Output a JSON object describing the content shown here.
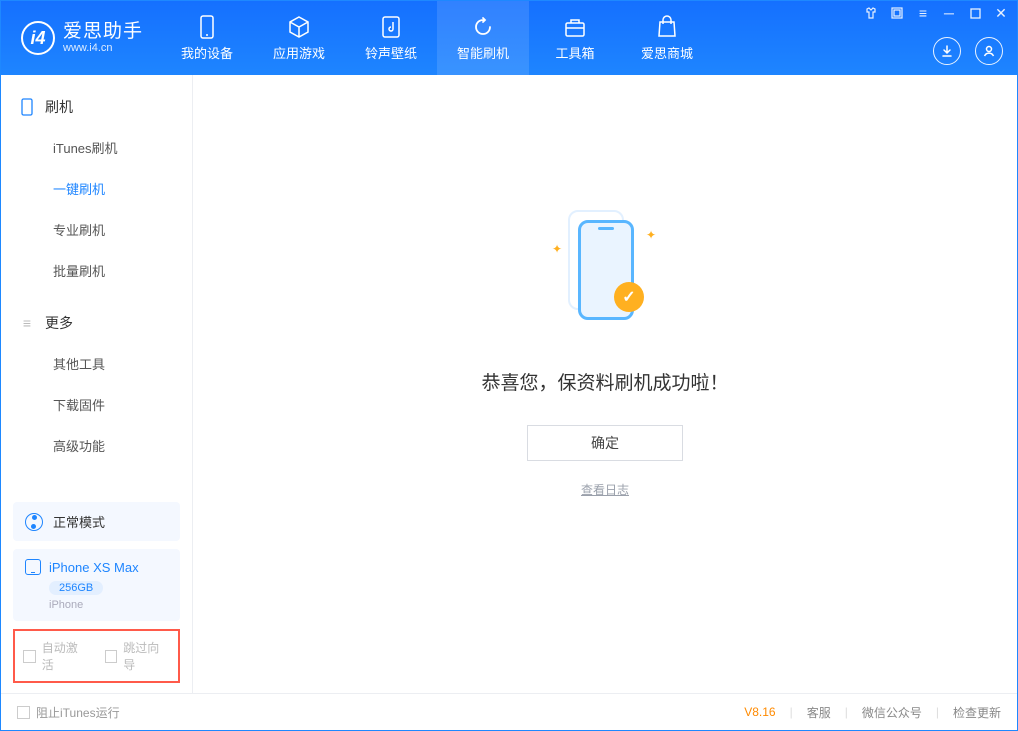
{
  "app": {
    "title": "爱思助手",
    "subtitle": "www.i4.cn"
  },
  "nav": [
    {
      "label": "我的设备",
      "icon": "device-icon"
    },
    {
      "label": "应用游戏",
      "icon": "cube-icon"
    },
    {
      "label": "铃声壁纸",
      "icon": "music-icon"
    },
    {
      "label": "智能刷机",
      "icon": "refresh-icon",
      "active": true
    },
    {
      "label": "工具箱",
      "icon": "toolbox-icon"
    },
    {
      "label": "爱思商城",
      "icon": "bag-icon"
    }
  ],
  "sidebar": {
    "section1": {
      "title": "刷机",
      "items": [
        "iTunes刷机",
        "一键刷机",
        "专业刷机",
        "批量刷机"
      ],
      "activeIndex": 1
    },
    "section2": {
      "title": "更多",
      "items": [
        "其他工具",
        "下载固件",
        "高级功能"
      ]
    },
    "mode": {
      "label": "正常模式"
    },
    "device": {
      "name": "iPhone XS Max",
      "storage": "256GB",
      "type": "iPhone"
    },
    "options": {
      "autoActivate": "自动激活",
      "skipWizard": "跳过向导"
    }
  },
  "main": {
    "title": "恭喜您，保资料刷机成功啦！",
    "okLabel": "确定",
    "logLabel": "查看日志"
  },
  "status": {
    "blockItunes": "阻止iTunes运行",
    "version": "V8.16",
    "links": [
      "客服",
      "微信公众号",
      "检查更新"
    ]
  }
}
